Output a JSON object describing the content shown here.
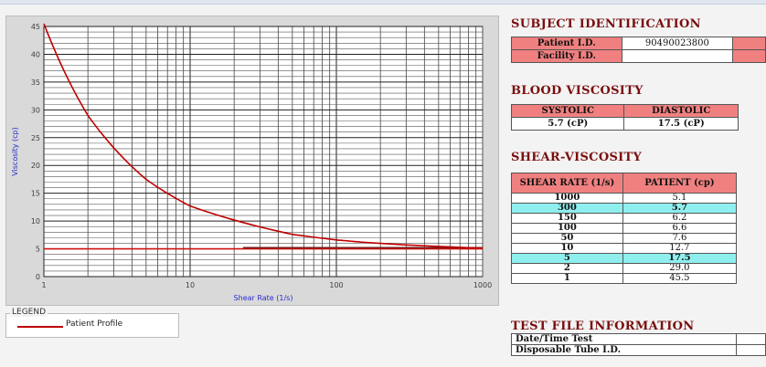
{
  "chart_data": {
    "type": "line",
    "xlabel": "Shear Rate (1/s)",
    "ylabel": "Viscosity (cp)",
    "x_scale": "log",
    "xlim": [
      1,
      1000
    ],
    "ylim": [
      0,
      45
    ],
    "x_ticks": [
      "1",
      "10",
      "100",
      "1000"
    ],
    "y_ticks": [
      "0",
      "5",
      "10",
      "15",
      "20",
      "25",
      "30",
      "35",
      "40",
      "45"
    ],
    "grid": true,
    "series": [
      {
        "name": "Patient Profile",
        "x": [
          1,
          2,
          5,
          10,
          50,
          100,
          150,
          300,
          1000
        ],
        "y": [
          45.5,
          29.0,
          17.5,
          12.7,
          7.6,
          6.6,
          6.2,
          5.7,
          5.1
        ],
        "color": "#c00000"
      }
    ],
    "reference_lines": [
      {
        "y": 5.0,
        "x_from": 1,
        "x_to": 1000,
        "color": "#d01010"
      },
      {
        "y": 5.2,
        "x_from": 23,
        "x_to": 1000,
        "color": "#7a1a1a"
      }
    ]
  },
  "legend": {
    "title": "LEGEND",
    "entries": [
      "Patient Profile"
    ]
  },
  "subject": {
    "title": "SUBJECT IDENTIFICATION",
    "patient_label": "Patient I.D.",
    "patient_value": "90490023800",
    "facility_label": "Facility I.D.",
    "facility_value": ""
  },
  "blood_viscosity": {
    "title": "BLOOD VISCOSITY",
    "systolic_label": "SYSTOLIC",
    "diastolic_label": "DIASTOLIC",
    "systolic_value": "5.7 (cP)",
    "diastolic_value": "17.5 (cP)"
  },
  "shear": {
    "title": "SHEAR-VISCOSITY",
    "col_rate": "SHEAR RATE (1/s)",
    "col_patient": "PATIENT (cp)",
    "rows": [
      {
        "rate": "1000",
        "value": "5.1",
        "highlight": false
      },
      {
        "rate": "300",
        "value": "5.7",
        "highlight": true
      },
      {
        "rate": "150",
        "value": "6.2",
        "highlight": false
      },
      {
        "rate": "100",
        "value": "6.6",
        "highlight": false
      },
      {
        "rate": "50",
        "value": "7.6",
        "highlight": false
      },
      {
        "rate": "10",
        "value": "12.7",
        "highlight": false
      },
      {
        "rate": "5",
        "value": "17.5",
        "highlight": true
      },
      {
        "rate": "2",
        "value": "29.0",
        "highlight": false
      },
      {
        "rate": "1",
        "value": "45.5",
        "highlight": false
      }
    ]
  },
  "test_file": {
    "title": "TEST FILE INFORMATION",
    "date_label": "Date/Time Test",
    "date_value": "",
    "tube_label": "Disposable Tube I.D.",
    "tube_value": ""
  }
}
